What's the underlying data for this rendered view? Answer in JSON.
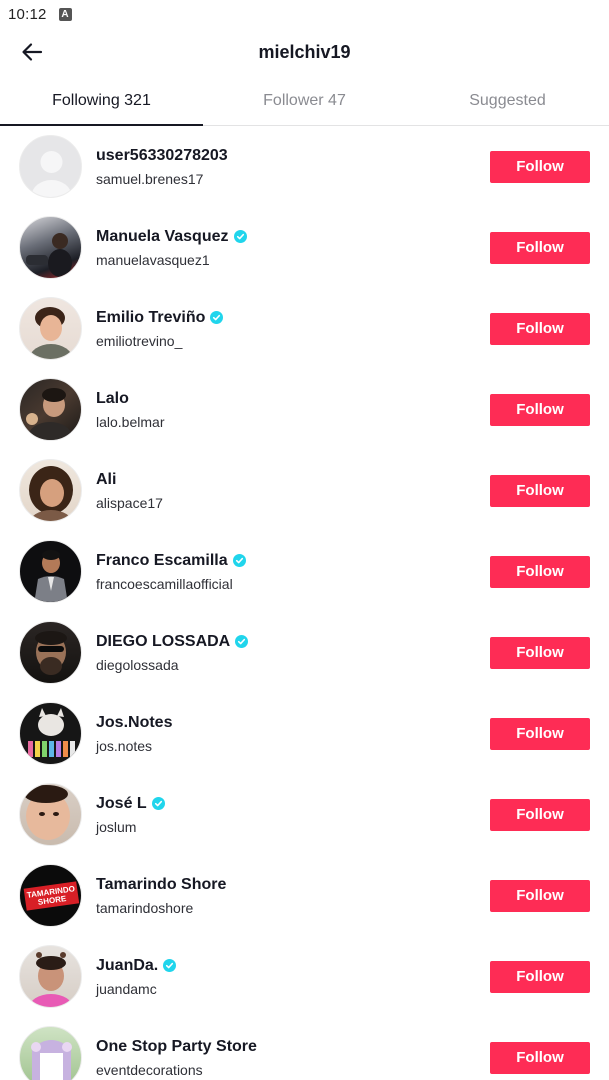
{
  "status_bar": {
    "time": "10:12",
    "notification_icon": "a-letter-icon"
  },
  "header": {
    "title": "mielchiv19",
    "back_icon": "arrow-left-icon"
  },
  "tabs": [
    {
      "label": "Following 321",
      "active": true
    },
    {
      "label": "Follower 47",
      "active": false
    },
    {
      "label": "Suggested",
      "active": false
    }
  ],
  "users": [
    {
      "name": "user56330278203",
      "handle": "samuel.brenes17",
      "verified": false,
      "avatar": "default-avatar",
      "button": "Follow"
    },
    {
      "name": "Manuela Vasquez",
      "handle": "manuelavasquez1",
      "verified": true,
      "avatar": "photo",
      "button": "Follow"
    },
    {
      "name": "Emilio Treviño",
      "handle": "emiliotrevino_",
      "verified": true,
      "avatar": "photo",
      "button": "Follow"
    },
    {
      "name": "Lalo",
      "handle": "lalo.belmar",
      "verified": false,
      "avatar": "photo",
      "button": "Follow"
    },
    {
      "name": "Ali",
      "handle": "alispace17",
      "verified": false,
      "avatar": "photo",
      "button": "Follow"
    },
    {
      "name": "Franco Escamilla",
      "handle": "francoescamillaofficial",
      "verified": true,
      "avatar": "photo",
      "button": "Follow"
    },
    {
      "name": "DIEGO LOSSADA",
      "handle": "diegolossada",
      "verified": true,
      "avatar": "photo",
      "button": "Follow"
    },
    {
      "name": "Jos.Notes",
      "handle": "jos.notes",
      "verified": false,
      "avatar": "photo",
      "button": "Follow"
    },
    {
      "name": "José L",
      "handle": "joslum",
      "verified": true,
      "avatar": "photo",
      "button": "Follow"
    },
    {
      "name": "Tamarindo Shore",
      "handle": "tamarindoshore",
      "verified": false,
      "avatar": "logo",
      "logo_text": "TAMARINDO SHORE",
      "button": "Follow"
    },
    {
      "name": "JuanDa.",
      "handle": "juandamc",
      "verified": true,
      "avatar": "photo",
      "button": "Follow"
    },
    {
      "name": "One Stop Party Store",
      "handle": "eventdecorations",
      "verified": false,
      "avatar": "photo",
      "button": "Follow"
    }
  ],
  "colors": {
    "accent": "#fe2c55",
    "verified": "#20d5ec",
    "text_primary": "#161823",
    "text_secondary": "#8a8b91"
  }
}
